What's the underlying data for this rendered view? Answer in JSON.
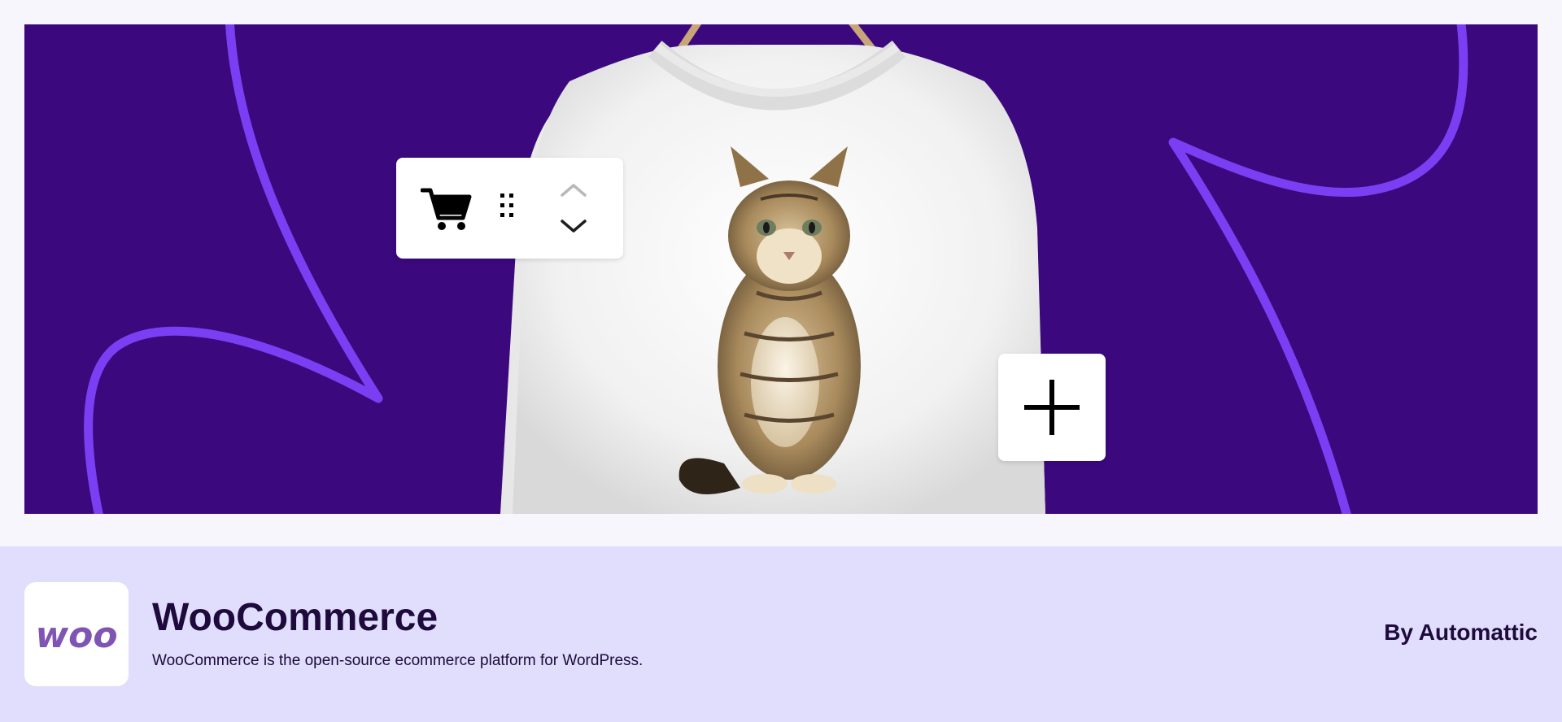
{
  "banner": {
    "background_color": "#3c087e",
    "curve_color": "#7b3ff3",
    "image_subject": "white sweatshirt on wooden hanger printed with a tabby kitten",
    "toolbar": {
      "cart_icon": "cart-icon",
      "drag_icon": "drag-handle-icon",
      "move_up_icon": "chevron-up-icon",
      "move_down_icon": "chevron-down-icon"
    },
    "add_button_icon": "plus-icon"
  },
  "plugin": {
    "logo_text": "woo",
    "logo_color": "#7f54b3",
    "name": "WooCommerce",
    "description": "WooCommerce is the open-source ecommerce platform for WordPress.",
    "author": "By Automattic"
  },
  "colors": {
    "page_background": "#f8f6fd",
    "footer_background": "#e0defc",
    "text_primary": "#1e0a3c"
  }
}
